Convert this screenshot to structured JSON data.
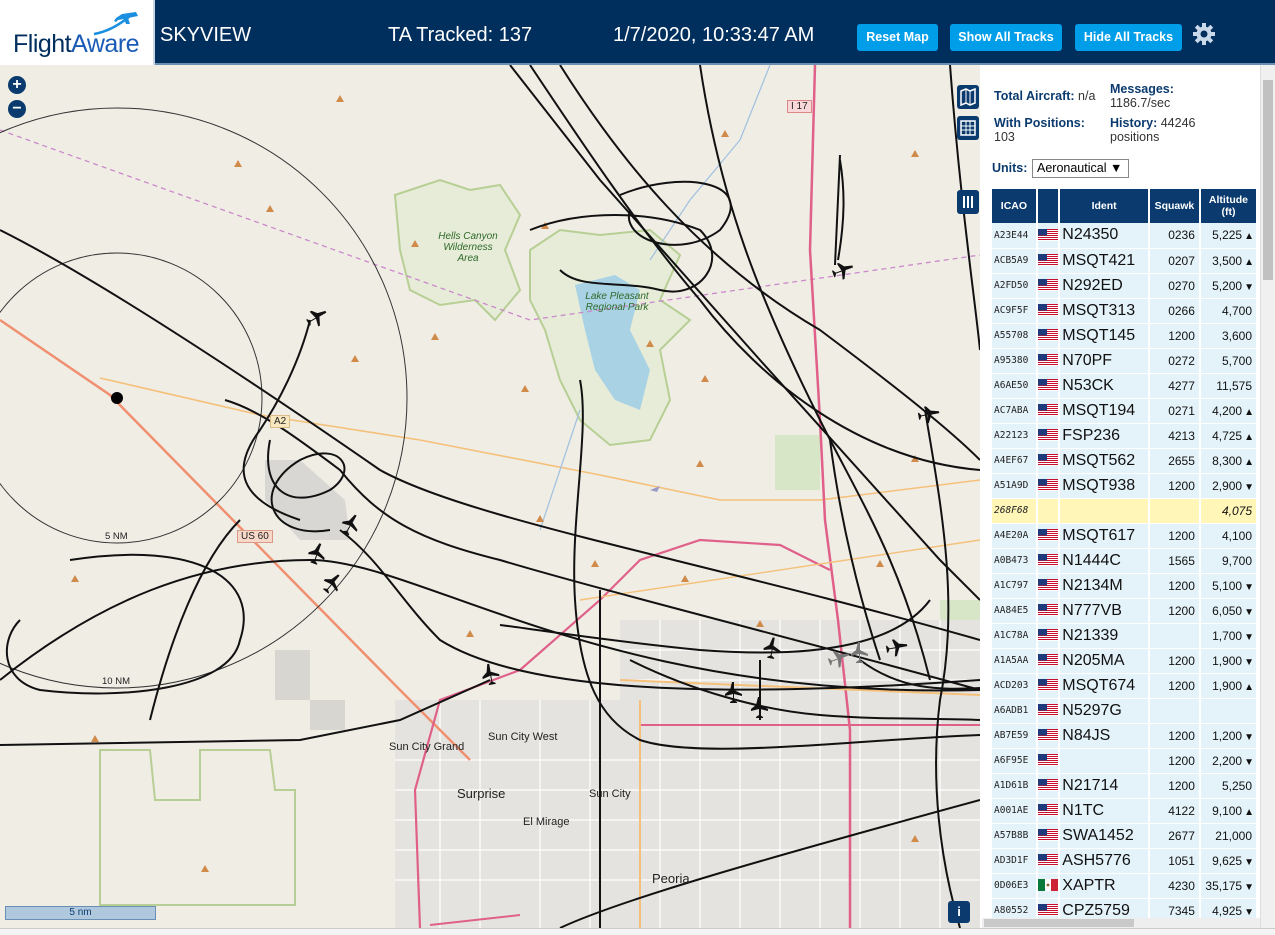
{
  "header": {
    "logo_part1": "Flight",
    "logo_part2": "Aware",
    "site": "SKYVIEW",
    "tracked": "TA Tracked: 137",
    "datetime": "1/7/2020, 10:33:47 AM",
    "btn_reset": "Reset Map",
    "btn_show": "Show All Tracks",
    "btn_hide": "Hide All Tracks"
  },
  "map": {
    "zoom_in": "+",
    "zoom_out": "−",
    "ring_5": "5 NM",
    "ring_10": "10 NM",
    "scale": "5 nm",
    "info": "i",
    "places": {
      "sun_city_grand": "Sun City Grand",
      "sun_city_west": "Sun City West",
      "surprise": "Surprise",
      "sun_city": "Sun City",
      "el_mirage": "El Mirage",
      "peoria": "Peoria"
    },
    "parks": {
      "hells_canyon": "Hells Canyon Wilderness Area",
      "lake_pleasant": "Lake Pleasant Regional Park"
    },
    "shields": {
      "i17": "I 17",
      "us60": "US 60",
      "a2": "A2"
    }
  },
  "stats": {
    "total_label": "Total Aircraft:",
    "total_value": "n/a",
    "messages_label": "Messages:",
    "messages_value": "1186.7/sec",
    "positions_label": "With Positions:",
    "positions_value": "103",
    "history_label": "History:",
    "history_value": "44246",
    "history_unit": "positions"
  },
  "units": {
    "label": "Units:",
    "value": "Aeronautical"
  },
  "table": {
    "headers": {
      "icao": "ICAO",
      "ident": "Ident",
      "squawk": "Squawk",
      "altitude": "Altitude",
      "altitude_unit": "(ft)"
    },
    "rows": [
      {
        "icao": "A23E44",
        "flag": "us",
        "ident": "N24350",
        "squawk": "0236",
        "alt": "5,225",
        "trend": "▲"
      },
      {
        "icao": "ACB5A9",
        "flag": "us",
        "ident": "MSQT421",
        "squawk": "0207",
        "alt": "3,500",
        "trend": "▲"
      },
      {
        "icao": "A2FD50",
        "flag": "us",
        "ident": "N292ED",
        "squawk": "0270",
        "alt": "5,200",
        "trend": "▼"
      },
      {
        "icao": "AC9F5F",
        "flag": "us",
        "ident": "MSQT313",
        "squawk": "0266",
        "alt": "4,700",
        "trend": ""
      },
      {
        "icao": "A55708",
        "flag": "us",
        "ident": "MSQT145",
        "squawk": "1200",
        "alt": "3,600",
        "trend": ""
      },
      {
        "icao": "A95380",
        "flag": "us",
        "ident": "N70PF",
        "squawk": "0272",
        "alt": "5,700",
        "trend": ""
      },
      {
        "icao": "A6AE50",
        "flag": "us",
        "ident": "N53CK",
        "squawk": "4277",
        "alt": "11,575",
        "trend": ""
      },
      {
        "icao": "AC7ABA",
        "flag": "us",
        "ident": "MSQT194",
        "squawk": "0271",
        "alt": "4,200",
        "trend": "▲"
      },
      {
        "icao": "A22123",
        "flag": "us",
        "ident": "FSP236",
        "squawk": "4213",
        "alt": "4,725",
        "trend": "▲"
      },
      {
        "icao": "A4EF67",
        "flag": "us",
        "ident": "MSQT562",
        "squawk": "2655",
        "alt": "8,300",
        "trend": "▲"
      },
      {
        "icao": "A51A9D",
        "flag": "us",
        "ident": "MSQT938",
        "squawk": "1200",
        "alt": "2,900",
        "trend": "▼"
      },
      {
        "icao": "268F68",
        "flag": "",
        "ident": "",
        "squawk": "",
        "alt": "4,075",
        "trend": "",
        "selected": true
      },
      {
        "icao": "A4E20A",
        "flag": "us",
        "ident": "MSQT617",
        "squawk": "1200",
        "alt": "4,100",
        "trend": ""
      },
      {
        "icao": "A0B473",
        "flag": "us",
        "ident": "N1444C",
        "squawk": "1565",
        "alt": "9,700",
        "trend": ""
      },
      {
        "icao": "A1C797",
        "flag": "us",
        "ident": "N2134M",
        "squawk": "1200",
        "alt": "5,100",
        "trend": "▼"
      },
      {
        "icao": "AA84E5",
        "flag": "us",
        "ident": "N777VB",
        "squawk": "1200",
        "alt": "6,050",
        "trend": "▼"
      },
      {
        "icao": "A1C78A",
        "flag": "us",
        "ident": "N21339",
        "squawk": "",
        "alt": "1,700",
        "trend": "▼"
      },
      {
        "icao": "A1A5AA",
        "flag": "us",
        "ident": "N205MA",
        "squawk": "1200",
        "alt": "1,900",
        "trend": "▼"
      },
      {
        "icao": "ACD203",
        "flag": "us",
        "ident": "MSQT674",
        "squawk": "1200",
        "alt": "1,900",
        "trend": "▲"
      },
      {
        "icao": "A6ADB1",
        "flag": "us",
        "ident": "N5297G",
        "squawk": "",
        "alt": "",
        "trend": ""
      },
      {
        "icao": "AB7E59",
        "flag": "us",
        "ident": "N84JS",
        "squawk": "1200",
        "alt": "1,200",
        "trend": "▼"
      },
      {
        "icao": "A6F95E",
        "flag": "us",
        "ident": "",
        "squawk": "1200",
        "alt": "2,200",
        "trend": "▼"
      },
      {
        "icao": "A1D61B",
        "flag": "us",
        "ident": "N21714",
        "squawk": "1200",
        "alt": "5,250",
        "trend": ""
      },
      {
        "icao": "A001AE",
        "flag": "us",
        "ident": "N1TC",
        "squawk": "4122",
        "alt": "9,100",
        "trend": "▲"
      },
      {
        "icao": "A57B8B",
        "flag": "us",
        "ident": "SWA1452",
        "squawk": "2677",
        "alt": "21,000",
        "trend": ""
      },
      {
        "icao": "AD3D1F",
        "flag": "us",
        "ident": "ASH5776",
        "squawk": "1051",
        "alt": "9,625",
        "trend": "▼"
      },
      {
        "icao": "0D06E3",
        "flag": "mx",
        "ident": "XAPTR",
        "squawk": "4230",
        "alt": "35,175",
        "trend": "▼"
      },
      {
        "icao": "A80552",
        "flag": "us",
        "ident": "CPZ5759",
        "squawk": "7345",
        "alt": "4,925",
        "trend": "▼"
      }
    ]
  }
}
